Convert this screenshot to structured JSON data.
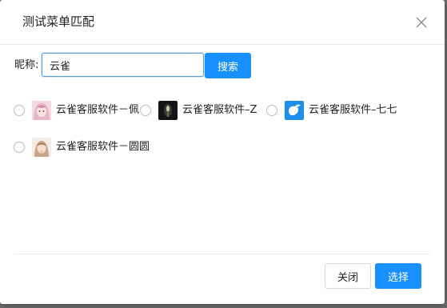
{
  "dialog": {
    "title": "测试菜单匹配",
    "close_icon": "close-icon"
  },
  "search": {
    "label": "昵称:",
    "value": "云雀",
    "button_label": "搜索"
  },
  "results": [
    {
      "name": "云雀客服软件－佩",
      "avatar": "anime-girl-avatar",
      "selected": false
    },
    {
      "name": "云雀客服软件–Z",
      "avatar": "dark-tunnel-avatar",
      "selected": false
    },
    {
      "name": "云雀客服软件–七七",
      "avatar": "blue-bird-avatar",
      "selected": false
    },
    {
      "name": "云雀客服软件－圆圆",
      "avatar": "girl-photo-avatar",
      "selected": false
    }
  ],
  "footer": {
    "close_label": "关闭",
    "select_label": "选择"
  },
  "colors": {
    "primary": "#1890ff",
    "input_focus": "#5b9bd5",
    "backdrop": "#6e6e6e"
  }
}
